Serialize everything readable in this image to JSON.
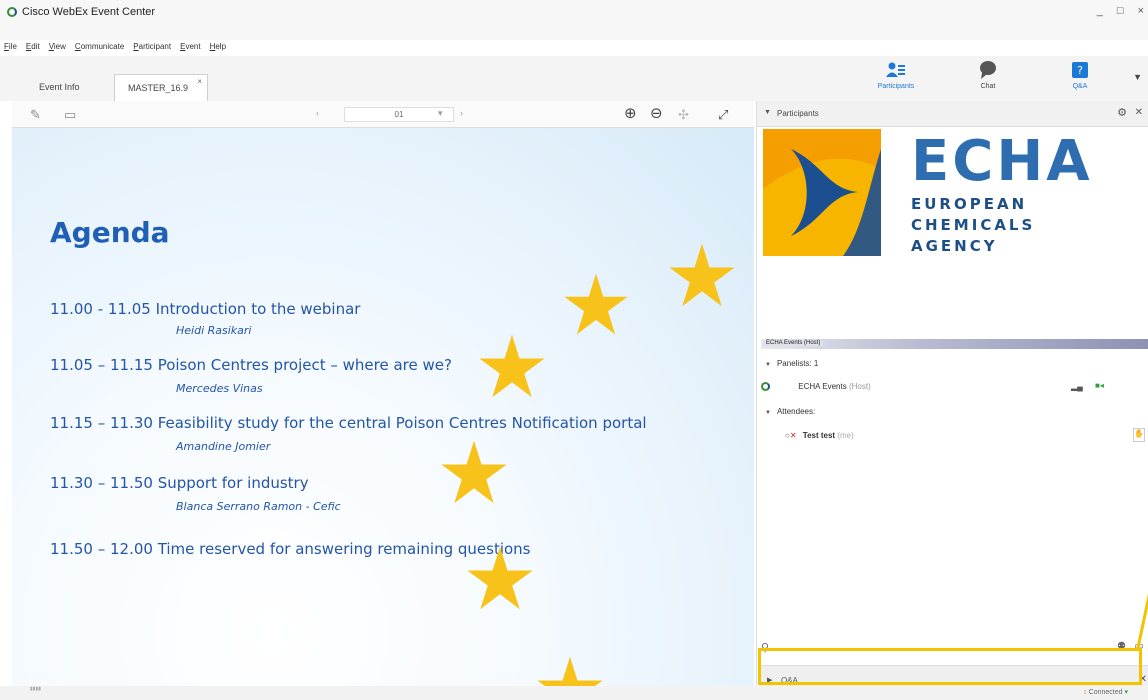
{
  "window": {
    "title": "Cisco WebEx Event Center",
    "controls": [
      "_",
      "□",
      "×"
    ]
  },
  "menu": [
    "File",
    "Edit",
    "View",
    "Communicate",
    "Participant",
    "Event",
    "Help"
  ],
  "tabs": [
    {
      "label": "Event Info"
    },
    {
      "label": "MASTER_16.9",
      "close": "×"
    }
  ],
  "top_buttons": [
    {
      "label": "Participants",
      "icon": "participants-icon"
    },
    {
      "label": "Chat",
      "icon": "chat-icon"
    },
    {
      "label": "Q&A",
      "icon": "qa-icon"
    }
  ],
  "content_toolbar": {
    "page": "01"
  },
  "slide": {
    "title": "Agenda",
    "items": [
      {
        "time_topic": "11.00 - 11.05  Introduction to the webinar",
        "presenter": "Heidi Rasikari"
      },
      {
        "time_topic": "11.05 – 11.15 Poison Centres project – where are we?",
        "presenter": "Mercedes Vinas"
      },
      {
        "time_topic": "11.15 – 11.30 Feasibility study for the central Poison Centres Notification portal",
        "presenter": "Amandine Jomier"
      },
      {
        "time_topic": "11.30 – 11.50 Support for industry",
        "presenter": "Blanca Serrano Ramon  - Cefic"
      },
      {
        "time_topic": "11.50 – 12.00 Time reserved for answering remaining questions",
        "presenter": ""
      }
    ]
  },
  "participants_panel": {
    "title": "Participants",
    "logo": {
      "word": "ECHA",
      "line1": "EUROPEAN",
      "line2": "CHEMICALS",
      "line3": "AGENCY"
    },
    "host_tag": "ECHA Events (Host)",
    "panelists_label": "Panelists: 1",
    "host_name": "ECHA Events",
    "host_suffix": "(Host)",
    "attendees_label": "Attendees:",
    "attendee_name": "Test test",
    "attendee_suffix": "(me)"
  },
  "qa_panel": {
    "title": "Q&A"
  },
  "status": {
    "connection": "Connected"
  },
  "colors": {
    "accent": "#1d79d6",
    "slide_text": "#2455a6",
    "star": "#f7c31a",
    "highlight": "#f2c300",
    "echa_blue": "#2d6db0"
  }
}
